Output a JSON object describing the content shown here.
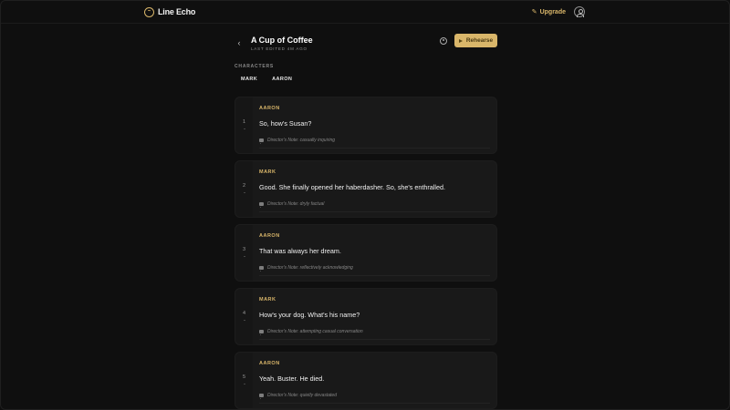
{
  "app": {
    "brand_icon": "logo-icon",
    "brand_name": "Line Echo",
    "upgrade_label": "Upgrade"
  },
  "script": {
    "back_icon": "chevron-left-icon",
    "title": "A Cup of Coffee",
    "edited": "LAST EDITED 4M AGO",
    "rehearse_label": "Rehearse",
    "characters_label": "CHARACTERS",
    "characters": [
      "MARK",
      "AARON"
    ]
  },
  "lines": [
    {
      "num": "1",
      "speaker": "AARON",
      "text": "So, how's Susan?",
      "note": "Director's Note: casually inquiring"
    },
    {
      "num": "2",
      "speaker": "MARK",
      "text": "Good. She finally opened her haberdasher. So, she's enthralled.",
      "note": "Director's Note: dryly factual"
    },
    {
      "num": "3",
      "speaker": "AARON",
      "text": "That was always her dream.",
      "note": "Director's Note: reflectively acknowledging"
    },
    {
      "num": "4",
      "speaker": "MARK",
      "text": "How's your dog. What's his name?",
      "note": "Director's Note: attempting casual conversation"
    },
    {
      "num": "5",
      "speaker": "AARON",
      "text": "Yeah. Buster. He died.",
      "note": "Director's Note: quietly devastated"
    }
  ],
  "colors": {
    "accent": "#d9b66a",
    "background": "#0f0f0f",
    "card": "#191919"
  }
}
